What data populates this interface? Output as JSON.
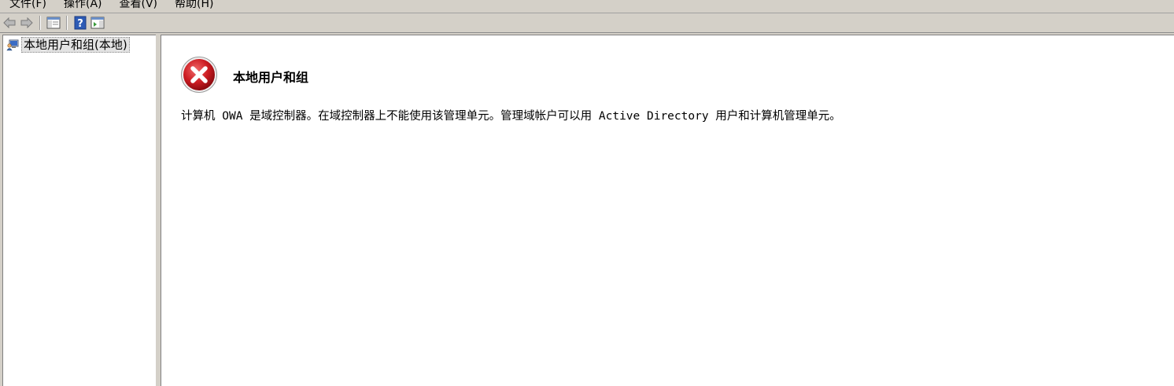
{
  "menu": {
    "items": [
      {
        "label": "文件(F)"
      },
      {
        "label": "操作(A)"
      },
      {
        "label": "查看(V)"
      },
      {
        "label": "帮助(H)"
      }
    ]
  },
  "toolbar": {
    "buttons": [
      {
        "icon": "back-arrow-icon"
      },
      {
        "icon": "forward-arrow-icon"
      },
      {
        "icon": "show-hide-console-tree-icon"
      },
      {
        "icon": "help-icon"
      },
      {
        "icon": "show-hide-action-pane-icon"
      }
    ]
  },
  "tree": {
    "root_label": "本地用户和组(本地)",
    "root_icon": "users-computer-icon"
  },
  "content": {
    "icon": "error-icon",
    "title": "本地用户和组",
    "message": "计算机 OWA 是域控制器。在域控制器上不能使用该管理单元。管理域帐户可以用 Active Directory 用户和计算机管理单元。"
  },
  "colors": {
    "chrome": "#d4d0c8",
    "error_red": "#c8161d",
    "pane_bg": "#ffffff"
  }
}
